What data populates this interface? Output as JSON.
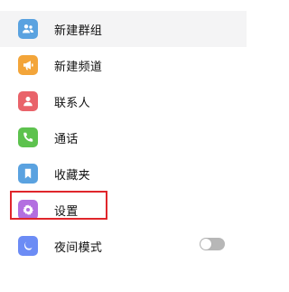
{
  "menu": {
    "items": [
      {
        "label": "新建群组",
        "icon": "group-icon",
        "icon_color": "#5aa2e0"
      },
      {
        "label": "新建频道",
        "icon": "megaphone-icon",
        "icon_color": "#f3a53a"
      },
      {
        "label": "联系人",
        "icon": "person-icon",
        "icon_color": "#e9636a"
      },
      {
        "label": "通话",
        "icon": "phone-icon",
        "icon_color": "#5dc24e"
      },
      {
        "label": "收藏夹",
        "icon": "bookmark-icon",
        "icon_color": "#5aa2e0"
      },
      {
        "label": "设置",
        "icon": "gear-icon",
        "icon_color": "#b36fe0"
      },
      {
        "label": "夜间模式",
        "icon": "moon-icon",
        "icon_color": "#6c8cf5"
      }
    ],
    "night_mode_enabled": false
  },
  "colors": {
    "active_bg": "#f4f4f5",
    "highlight_border": "#e0262b"
  }
}
